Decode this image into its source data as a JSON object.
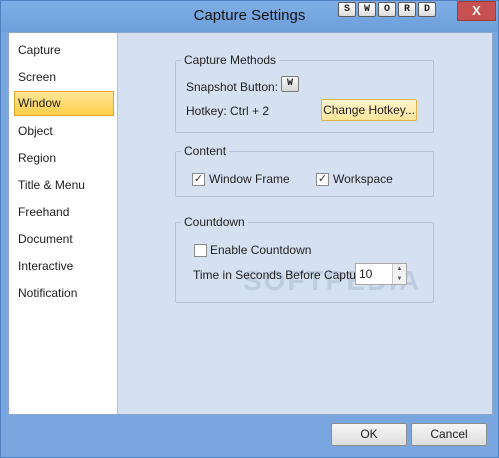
{
  "window": {
    "title": "Capture Settings",
    "sword_keys": [
      "S",
      "W",
      "O",
      "R",
      "D"
    ],
    "close_glyph": "X"
  },
  "sidebar": {
    "items": [
      {
        "label": "Capture"
      },
      {
        "label": "Screen"
      },
      {
        "label": "Window",
        "selected": true
      },
      {
        "label": "Object"
      },
      {
        "label": "Region"
      },
      {
        "label": "Title & Menu"
      },
      {
        "label": "Freehand"
      },
      {
        "label": "Document"
      },
      {
        "label": "Interactive"
      },
      {
        "label": "Notification"
      }
    ]
  },
  "capture_methods": {
    "title": "Capture Methods",
    "snapshot_label": "Snapshot Button:",
    "snapshot_button_glyph": "W",
    "hotkey_label": "Hotkey: Ctrl + 2",
    "change_hotkey_button": "Change Hotkey..."
  },
  "content_group": {
    "title": "Content",
    "window_frame": {
      "label": "Window Frame",
      "checked": true
    },
    "workspace": {
      "label": "Workspace",
      "checked": true
    },
    "check_glyph": "✓"
  },
  "countdown": {
    "title": "Countdown",
    "enable_label": "Enable Countdown",
    "enable_checked": false,
    "time_label": "Time in Seconds Before Capture",
    "time_value": "10"
  },
  "watermark": "SOFTPEDIA",
  "footer": {
    "ok": "OK",
    "cancel": "Cancel"
  },
  "colors": {
    "selected_bg": "#ffcf4a",
    "content_bg": "#d5e1f1",
    "titlebar": "#7eaee5",
    "close": "#c75050"
  }
}
